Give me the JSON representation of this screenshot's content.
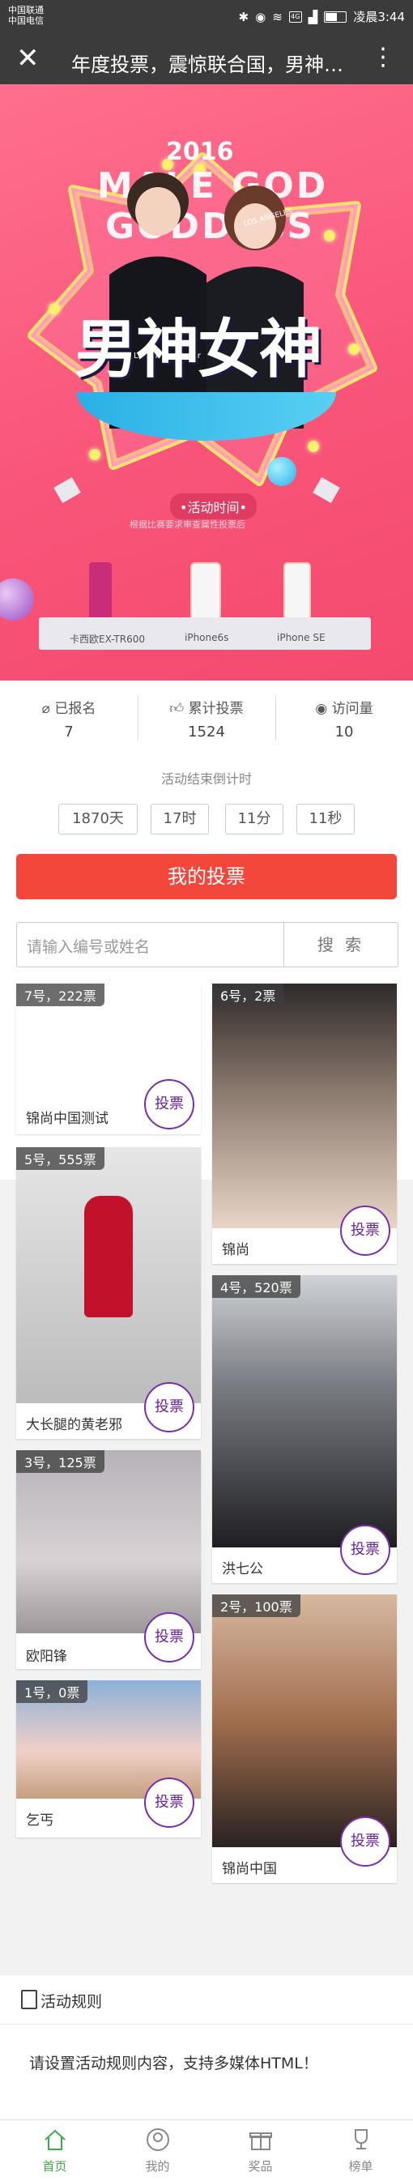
{
  "status_bar": {
    "carrier1": "中国联通",
    "carrier2": "中国电信",
    "icons": [
      "bluetooth-icon",
      "eye-icon",
      "wifi-icon",
      "4g-icon",
      "signal-icon",
      "battery-icon"
    ],
    "time": "凌晨3:44"
  },
  "navbar": {
    "close_icon": "close-icon",
    "title": "年度投票，震惊联合国，男神女神",
    "more_icon": "more-vertical-icon"
  },
  "banner": {
    "year": "2016",
    "en_line1": "MALE GOD",
    "en_line2": "GODDESS",
    "headline": "男神女神",
    "time_pill": "•活动时间•",
    "time_sub": "根据比赛要求审查属性投票后",
    "shirt_text": "Life is the flower",
    "cap_text": "LOS ANGELES",
    "prizes": [
      "卡西欧EX-TR600",
      "iPhone6s",
      "iPhone SE"
    ],
    "colors": {
      "bg": "#f9557a",
      "ribbon": "#2ab0e6"
    }
  },
  "stats": {
    "items": [
      {
        "icon": "paperclip-icon",
        "label": "已报名",
        "value": "7"
      },
      {
        "icon": "thumbs-up-icon",
        "label": "累计投票",
        "value": "1524"
      },
      {
        "icon": "eye-icon",
        "label": "访问量",
        "value": "10"
      }
    ]
  },
  "countdown": {
    "title": "活动结束倒计时",
    "days": "1870天",
    "hours": "17时",
    "minutes": "11分",
    "seconds": "11秒"
  },
  "my_vote": {
    "label": "我的投票",
    "color": "#f4473c"
  },
  "search": {
    "placeholder": "请输入编号或姓名",
    "button": "搜 索"
  },
  "contestants": [
    {
      "tag": "7号，222票",
      "name": "锦尚中国测试",
      "vote": "投票"
    },
    {
      "tag": "6号，2票",
      "name": "锦尚",
      "vote": "投票"
    },
    {
      "tag": "5号，555票",
      "name": "大长腿的黄老邪",
      "vote": "投票"
    },
    {
      "tag": "4号，520票",
      "name": "洪七公",
      "vote": "投票"
    },
    {
      "tag": "3号，125票",
      "name": "欧阳锋",
      "vote": "投票"
    },
    {
      "tag": "2号，100票",
      "name": "锦尚中国",
      "vote": "投票"
    },
    {
      "tag": "1号，0票",
      "name": "乞丐",
      "vote": "投票"
    }
  ],
  "rules": {
    "icon": "document-icon",
    "title": "活动规则",
    "body": "请设置活动规则内容，支持多媒体HTML！"
  },
  "tabbar": {
    "active_color": "#3dac45",
    "items": [
      {
        "icon": "home-icon",
        "label": "首页",
        "active": true
      },
      {
        "icon": "user-icon",
        "label": "我的",
        "active": false
      },
      {
        "icon": "gift-icon",
        "label": "奖品",
        "active": false
      },
      {
        "icon": "trophy-icon",
        "label": "榜单",
        "active": false
      }
    ]
  }
}
